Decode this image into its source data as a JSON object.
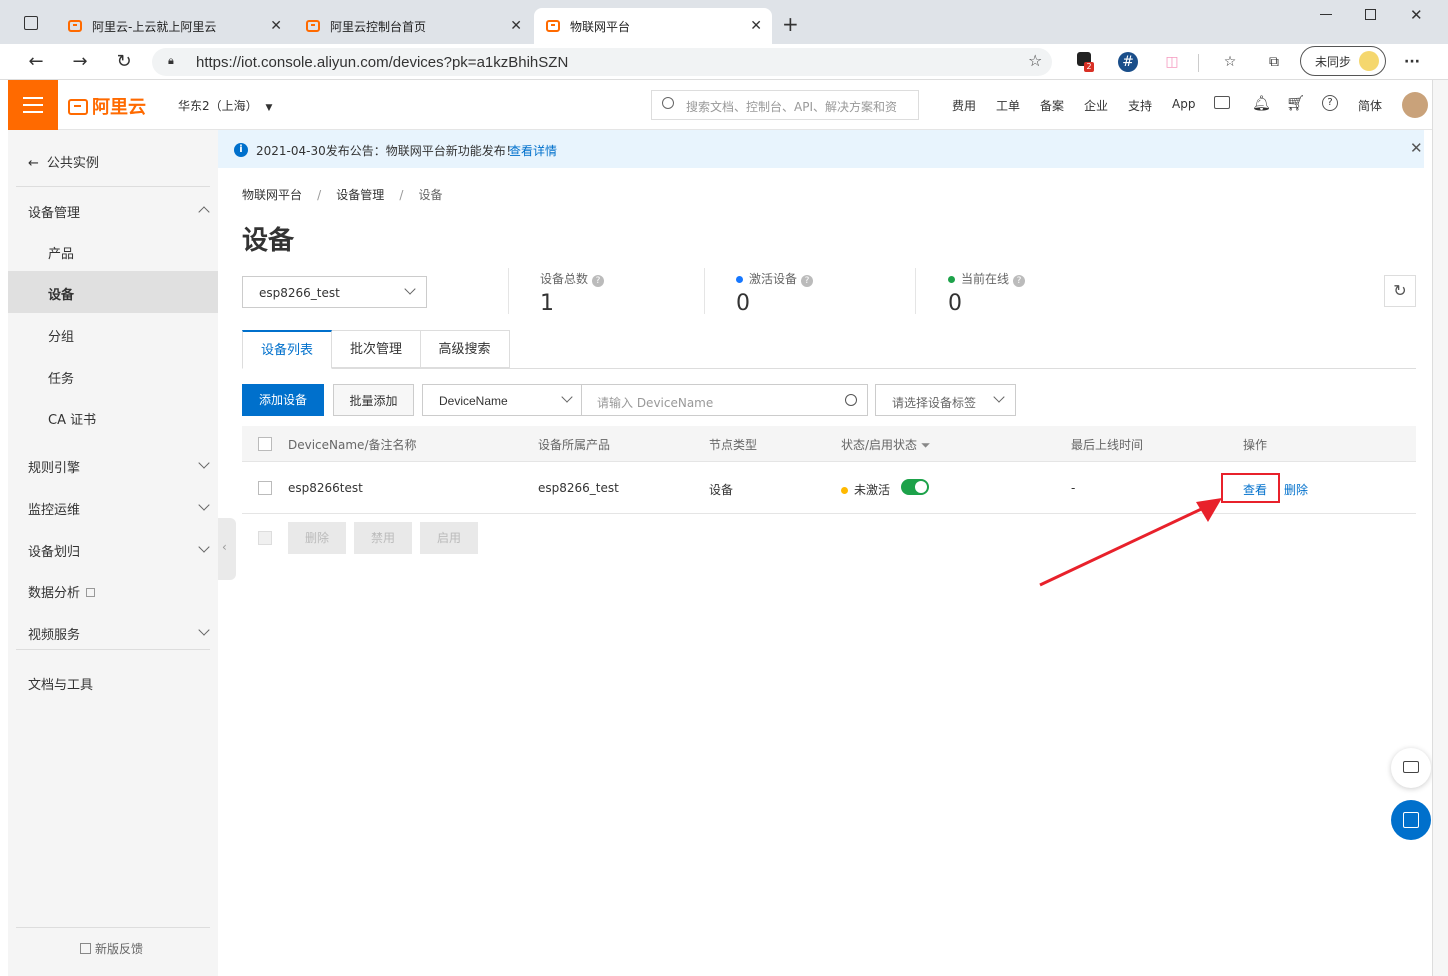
{
  "browser": {
    "tabs": [
      {
        "title": "阿里云-上云就上阿里云",
        "active": false
      },
      {
        "title": "阿里云控制台首页",
        "active": false
      },
      {
        "title": "物联网平台",
        "active": true
      }
    ],
    "url": "https://iot.console.aliyun.com/devices?pk=a1kzBhihSZN",
    "sync_label": "未同步",
    "badge_count": "2"
  },
  "topnav": {
    "logo": "阿里云",
    "region": "华东2（上海）",
    "search_placeholder": "搜索文档、控制台、API、解决方案和资",
    "items": [
      "费用",
      "工单",
      "备案",
      "企业",
      "支持",
      "App",
      "简体"
    ]
  },
  "sidebar": {
    "back_label": "公共实例",
    "group1": "设备管理",
    "items": [
      "产品",
      "设备",
      "分组",
      "任务",
      "CA 证书"
    ],
    "groups": [
      "规则引擎",
      "监控运维",
      "设备划归",
      "数据分析",
      "视频服务"
    ],
    "docs": "文档与工具",
    "feedback": "新版反馈"
  },
  "notice": {
    "text": "2021-04-30发布公告：物联网平台新功能发布！",
    "link": "查看详情"
  },
  "page": {
    "breadcrumb": [
      "物联网平台",
      "设备管理",
      "设备"
    ],
    "title": "设备",
    "product_select": "esp8266_test",
    "stats": [
      {
        "label": "设备总数",
        "value": "1",
        "dot": ""
      },
      {
        "label": "激活设备",
        "value": "0",
        "dot": "#1677ff"
      },
      {
        "label": "当前在线",
        "value": "0",
        "dot": "#1da24a"
      }
    ],
    "tabs": [
      "设备列表",
      "批次管理",
      "高级搜索"
    ],
    "add_button": "添加设备",
    "batch_add_button": "批量添加",
    "filter_field": "DeviceName",
    "filter_placeholder": "请输入 DeviceName",
    "tag_placeholder": "请选择设备标签",
    "columns": [
      "DeviceName/备注名称",
      "设备所属产品",
      "节点类型",
      "状态/启用状态",
      "最后上线时间",
      "操作"
    ],
    "row": {
      "name": "esp8266test",
      "product": "esp8266_test",
      "node_type": "设备",
      "status": "未激活",
      "last_online": "-",
      "action_view": "查看",
      "action_delete": "删除"
    },
    "bulk_actions": [
      "删除",
      "禁用",
      "启用"
    ]
  },
  "colors": {
    "brand": "#ff6a00",
    "primary": "#0070cc",
    "toggle_on": "#1da24a",
    "status_inactive": "#ffb900",
    "annotation": "#e8212b"
  }
}
